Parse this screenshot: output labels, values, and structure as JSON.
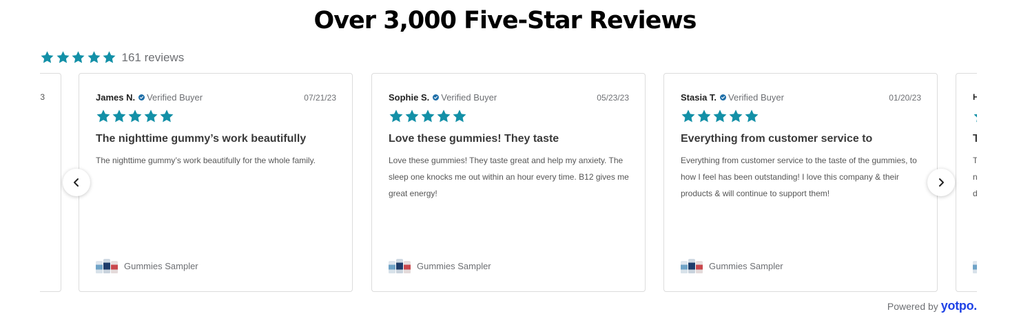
{
  "header": {
    "title": "Over 3,000 Five-Star Reviews"
  },
  "summary": {
    "rating": 5,
    "count_text": "161 reviews"
  },
  "colors": {
    "star": "#1390a7",
    "brand": "#1f42e6",
    "verified": "#1f6fa8"
  },
  "partial_left": {
    "date_fragment": "3"
  },
  "reviews": [
    {
      "reviewer": "James N.",
      "badge": "Verified Buyer",
      "date": "07/21/23",
      "rating": 5,
      "title": "The nighttime gummy’s work beautifully",
      "body": "The nighttime gummy’s work beautifully for the whole family.",
      "product": "Gummies Sampler"
    },
    {
      "reviewer": "Sophie S.",
      "badge": "Verified Buyer",
      "date": "05/23/23",
      "rating": 5,
      "title": "Love these gummies! They taste",
      "body": "Love these gummies! They taste great and help my anxiety. The sleep one knocks me out within an hour every time. B12 gives me great energy!",
      "product": "Gummies Sampler"
    },
    {
      "reviewer": "Stasia T.",
      "badge": "Verified Buyer",
      "date": "01/20/23",
      "rating": 5,
      "title": "Everything from customer service to",
      "body": "Everything from customer service to the taste of the gummies, to how I feel has been outstanding! I love this company & their products & will continue to support them!",
      "product": "Gummies Sampler"
    }
  ],
  "partial_right": {
    "name_fragment": "H",
    "title_fragment": "T",
    "body_lines": [
      "T",
      "n",
      "d"
    ]
  },
  "nav": {
    "prev_icon": "chevron-left-icon",
    "next_icon": "chevron-right-icon"
  },
  "footer": {
    "powered_label": "Powered by",
    "brand": "yotpo."
  }
}
